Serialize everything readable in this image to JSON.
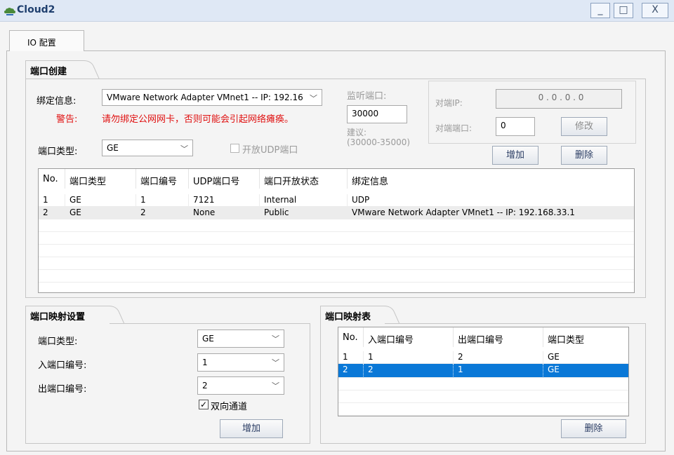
{
  "window": {
    "title": "Cloud2",
    "min_label": "_",
    "max_label": "□",
    "close_label": "X"
  },
  "tabs": [
    {
      "label": "IO 配置"
    }
  ],
  "port_create": {
    "title": "端口创建",
    "binding_label": "绑定信息:",
    "binding_value": "VMware Network Adapter VMnet1 -- IP: 192.16",
    "warning_label": "警告:",
    "warning_text": "请勿绑定公网网卡，否则可能会引起网络瘫痪。",
    "port_type_label": "端口类型:",
    "port_type_value": "GE",
    "open_udp_label": "开放UDP端口",
    "open_udp_checked": false,
    "listen_port_label": "监听端口:",
    "listen_port_value": "30000",
    "suggest_label": "建议:",
    "suggest_range": "(30000-35000)",
    "peer_ip_label": "对端IP:",
    "peer_ip_value": "0  .  0  .  0  .  0",
    "peer_port_label": "对端端口:",
    "peer_port_value": "0",
    "modify_button": "修改",
    "add_button": "增加",
    "delete_button": "删除",
    "table": {
      "columns": [
        "No.",
        "端口类型",
        "端口编号",
        "UDP端口号",
        "端口开放状态",
        "绑定信息"
      ],
      "rows": [
        [
          "1",
          "GE",
          "1",
          "7121",
          "Internal",
          "UDP"
        ],
        [
          "2",
          "GE",
          "2",
          "None",
          "Public",
          "VMware Network Adapter VMnet1 -- IP: 192.168.33.1"
        ]
      ]
    }
  },
  "port_map_settings": {
    "title": "端口映射设置",
    "port_type_label": "端口类型:",
    "port_type_value": "GE",
    "in_port_label": "入端口编号:",
    "in_port_value": "1",
    "out_port_label": "出端口编号:",
    "out_port_value": "2",
    "bidirectional_label": "双向通道",
    "bidirectional_checked": true,
    "add_button": "增加"
  },
  "port_map_table": {
    "title": "端口映射表",
    "columns": [
      "No.",
      "入端口编号",
      "出端口编号",
      "端口类型"
    ],
    "rows": [
      [
        "1",
        "1",
        "2",
        "GE"
      ],
      [
        "2",
        "2",
        "1",
        "GE"
      ]
    ],
    "selected_row": 2,
    "delete_button": "删除"
  },
  "colors": {
    "accent": "#0a78d7",
    "warning": "#e01010",
    "titlebar": "#dfe8f5"
  }
}
